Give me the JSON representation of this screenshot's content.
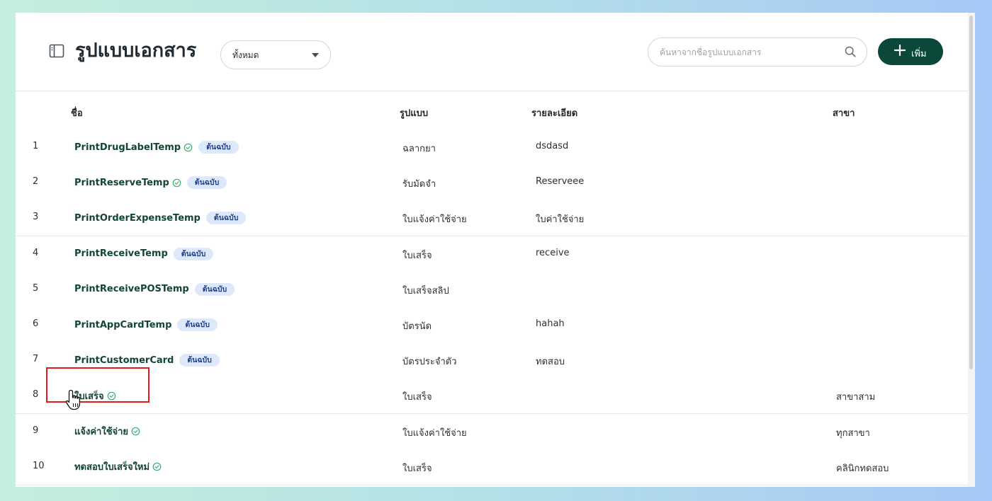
{
  "header": {
    "title": "รูปแบบเอกสาร",
    "filter": {
      "selected": "ทั้งหมด"
    },
    "search": {
      "placeholder": "ค้นหาจากชื่อรูปแบบเอกสาร",
      "value": ""
    },
    "add_label": "เพิ่ม"
  },
  "table": {
    "columns": {
      "name": "ชื่อ",
      "format": "รูปแบบ",
      "detail": "รายละเอียด",
      "branch": "สาขา"
    },
    "rows": [
      {
        "index": "1",
        "name": "PrintDrugLabelTemp",
        "verified": true,
        "badge": "ต้นฉบับ",
        "format": "ฉลากยา",
        "detail": "dsdasd",
        "branch": ""
      },
      {
        "index": "2",
        "name": "PrintReserveTemp",
        "verified": true,
        "badge": "ต้นฉบับ",
        "format": "รับมัดจำ",
        "detail": "Reserveee",
        "branch": ""
      },
      {
        "index": "3",
        "name": "PrintOrderExpenseTemp",
        "verified": false,
        "badge": "ต้นฉบับ",
        "format": "ใบแจ้งค่าใช้จ่าย",
        "detail": "ใบค่าใช้จ่าย",
        "branch": ""
      },
      {
        "index": "4",
        "name": "PrintReceiveTemp",
        "verified": false,
        "badge": "ต้นฉบับ",
        "format": "ใบเสร็จ",
        "detail": "receive",
        "branch": ""
      },
      {
        "index": "5",
        "name": "PrintReceivePOSTemp",
        "verified": false,
        "badge": "ต้นฉบับ",
        "format": "ใบเสร็จสลิป",
        "detail": "",
        "branch": ""
      },
      {
        "index": "6",
        "name": "PrintAppCardTemp",
        "verified": false,
        "badge": "ต้นฉบับ",
        "format": "บัตรนัด",
        "detail": "hahah",
        "branch": ""
      },
      {
        "index": "7",
        "name": "PrintCustomerCard",
        "verified": false,
        "badge": "ต้นฉบับ",
        "format": "บัตรประจำตัว",
        "detail": "ทดสอบ",
        "branch": ""
      },
      {
        "index": "8",
        "name": "ใบเสร็จ",
        "verified": true,
        "badge": "",
        "format": "ใบเสร็จ",
        "detail": "",
        "branch": "สาขาสาม"
      },
      {
        "index": "9",
        "name": "แจ้งค่าใช้จ่าย",
        "verified": true,
        "badge": "",
        "format": "ใบแจ้งค่าใช้จ่าย",
        "detail": "",
        "branch": "ทุกสาขา"
      },
      {
        "index": "10",
        "name": "ทดสอบใบเสร็จใหม่",
        "verified": true,
        "badge": "",
        "format": "ใบเสร็จ",
        "detail": "",
        "branch": "คลินิกทดสอบ"
      }
    ]
  },
  "icons": {
    "sidebar": "sidebar-panel-icon",
    "search": "search-icon",
    "add": "plus-icon",
    "verified": "check-circle-icon",
    "cursor": "hand-pointer-icon"
  },
  "colors": {
    "accent": "#0c4839",
    "link": "#124534",
    "badge_bg": "#dde9fb",
    "badge_text": "#1f3f8a",
    "verified": "#3dab73",
    "highlight": "#e31b1b"
  }
}
